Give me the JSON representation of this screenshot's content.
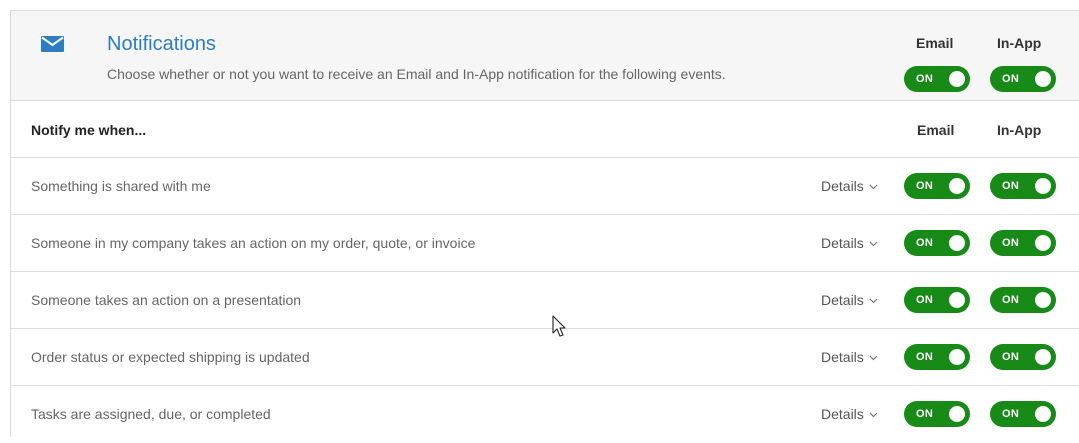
{
  "header": {
    "icon": "envelope-icon",
    "title": "Notifications",
    "description": "Choose whether or not you want to receive an Email and In-App notification for the following events.",
    "email_label": "Email",
    "inapp_label": "In-App",
    "email_toggle": "ON",
    "inapp_toggle": "ON"
  },
  "table": {
    "title": "Notify me when...",
    "email_col": "Email",
    "inapp_col": "In-App",
    "rows": [
      {
        "label": "Something is shared with me",
        "details": "Details",
        "email": "ON",
        "inapp": "ON"
      },
      {
        "label": "Someone in my company takes an action on my order, quote, or invoice",
        "details": "Details",
        "email": "ON",
        "inapp": "ON"
      },
      {
        "label": "Someone takes an action on a presentation",
        "details": "Details",
        "email": "ON",
        "inapp": "ON"
      },
      {
        "label": "Order status or expected shipping is updated",
        "details": "Details",
        "email": "ON",
        "inapp": "ON"
      },
      {
        "label": "Tasks are assigned, due, or completed",
        "details": "Details",
        "email": "ON",
        "inapp": "ON"
      }
    ]
  },
  "colors": {
    "accent": "#2c7ec2",
    "toggle_on": "#178a17"
  }
}
